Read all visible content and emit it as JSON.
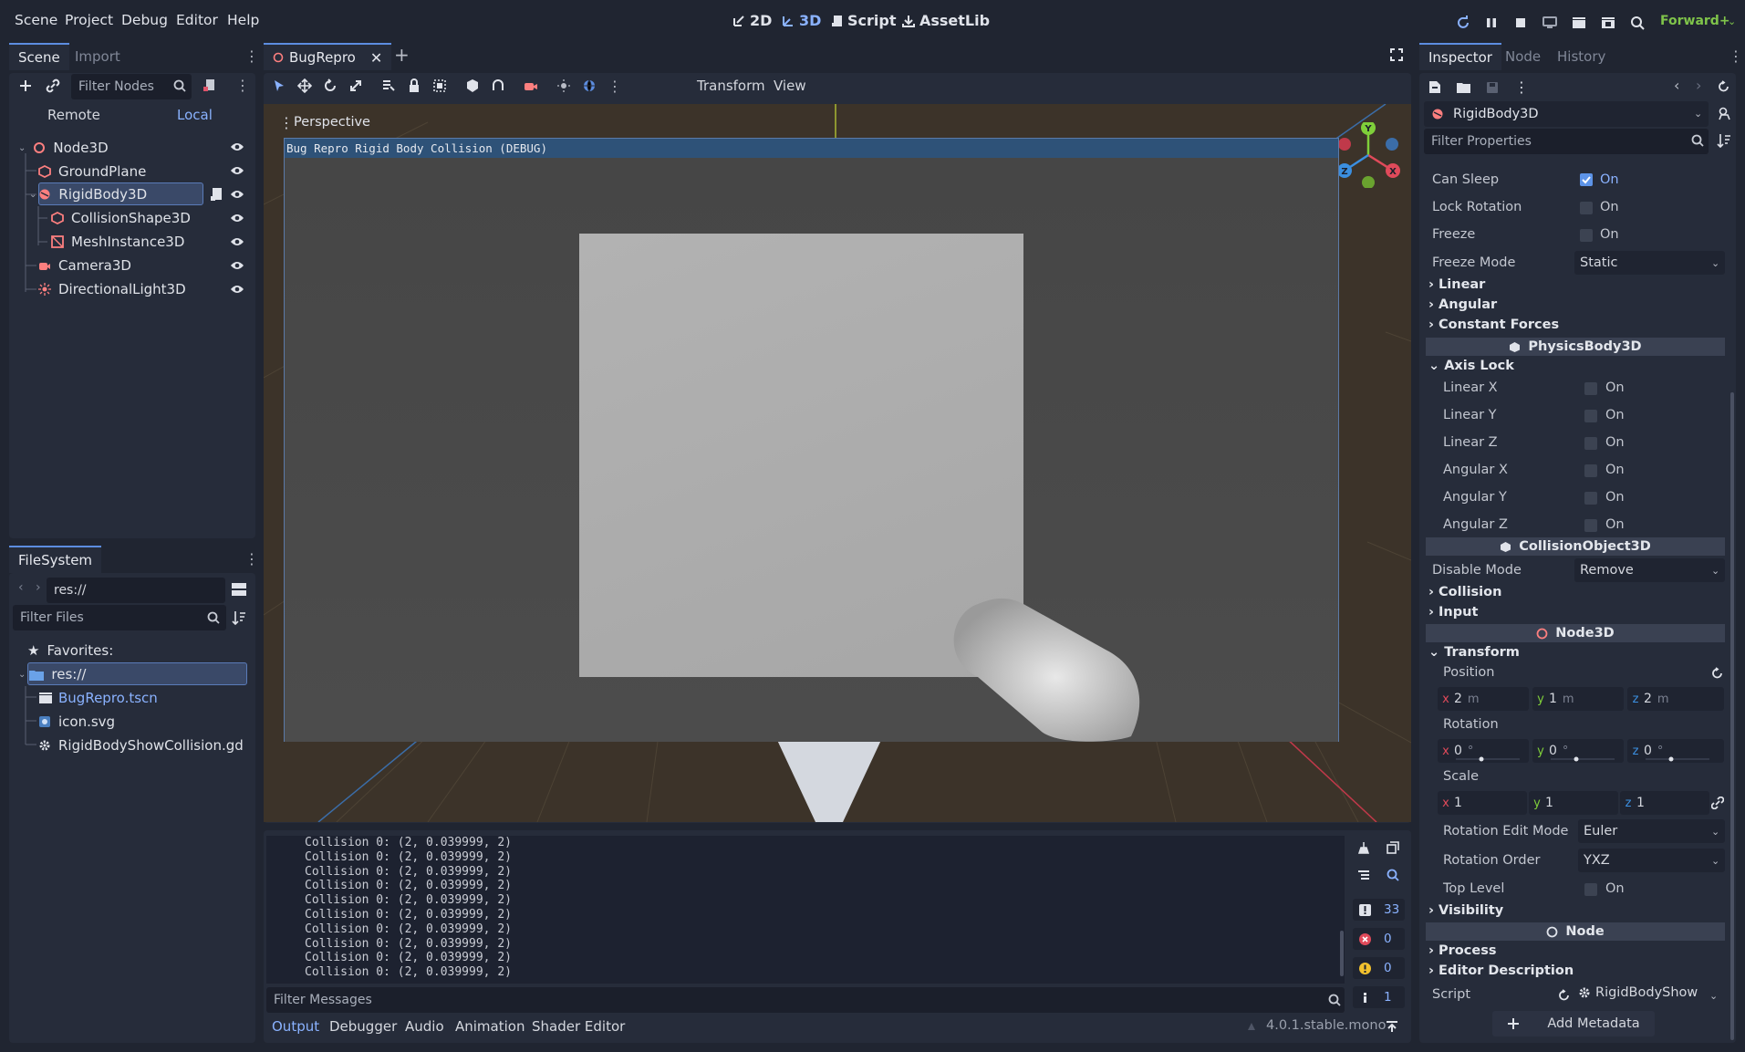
{
  "menu": [
    "Scene",
    "Project",
    "Debug",
    "Editor",
    "Help"
  ],
  "workspaces": {
    "w2d": "2D",
    "w3d": "3D",
    "script": "Script",
    "assetlib": "AssetLib"
  },
  "renderer": "Forward+",
  "scene_dock": {
    "tabs": [
      "Scene",
      "Import"
    ],
    "filter_placeholder": "Filter Nodes",
    "remote": "Remote",
    "local": "Local",
    "nodes": [
      "Node3D",
      "GroundPlane",
      "RigidBody3D",
      "CollisionShape3D",
      "MeshInstance3D",
      "Camera3D",
      "DirectionalLight3D"
    ]
  },
  "filesystem": {
    "tab": "FileSystem",
    "path": "res://",
    "filter_placeholder": "Filter Files",
    "favorites": "Favorites:",
    "root": "res://",
    "files": [
      "BugRepro.tscn",
      "icon.svg",
      "RigidBodyShowCollision.gd"
    ]
  },
  "editor_tabs": {
    "scene_tab": "BugRepro",
    "toolbar_transform": "Transform",
    "toolbar_view": "View"
  },
  "viewport": {
    "label": "Perspective",
    "game_window_title": "Bug Repro Rigid Body Collision (DEBUG)",
    "gizmo": {
      "y": "Y",
      "z": "Z",
      "x": "X"
    }
  },
  "output": {
    "lines": [
      "Collision 0: (2, 0.039999, 2)",
      "Collision 0: (2, 0.039999, 2)",
      "Collision 0: (2, 0.039999, 2)",
      "Collision 0: (2, 0.039999, 2)",
      "Collision 0: (2, 0.039999, 2)",
      "Collision 0: (2, 0.039999, 2)",
      "Collision 0: (2, 0.039999, 2)",
      "Collision 0: (2, 0.039999, 2)",
      "Collision 0: (2, 0.039999, 2)",
      "Collision 0: (2, 0.039999, 2)"
    ],
    "filter_placeholder": "Filter Messages",
    "counts": {
      "messages": "33",
      "errors": "0",
      "warnings": "0",
      "info": "1"
    }
  },
  "bottom_tabs": [
    "Output",
    "Debugger",
    "Audio",
    "Animation",
    "Shader Editor"
  ],
  "version": "4.0.1.stable.mono",
  "inspector": {
    "tabs": [
      "Inspector",
      "Node",
      "History"
    ],
    "object": "RigidBody3D",
    "filter_placeholder": "Filter Properties",
    "on": "On",
    "can_sleep": "Can Sleep",
    "lock_rotation": "Lock Rotation",
    "freeze": "Freeze",
    "freeze_mode": "Freeze Mode",
    "freeze_mode_value": "Static",
    "linear": "Linear",
    "angular": "Angular",
    "constant_forces": "Constant Forces",
    "physics_body": "PhysicsBody3D",
    "axis_lock": "Axis Lock",
    "axis_items": [
      "Linear X",
      "Linear Y",
      "Linear Z",
      "Angular X",
      "Angular Y",
      "Angular Z"
    ],
    "collision_object": "CollisionObject3D",
    "disable_mode": "Disable Mode",
    "disable_mode_value": "Remove",
    "collision": "Collision",
    "input": "Input",
    "node3d": "Node3D",
    "transform": "Transform",
    "position": "Position",
    "pos": {
      "x": "2",
      "y": "1",
      "z": "2",
      "unit": "m"
    },
    "rotation": "Rotation",
    "rot": {
      "x": "0",
      "y": "0",
      "z": "0",
      "unit": "°"
    },
    "scale": "Scale",
    "scl": {
      "x": "1",
      "y": "1",
      "z": "1"
    },
    "rotation_edit_mode": "Rotation Edit Mode",
    "rotation_edit_mode_value": "Euler",
    "rotation_order": "Rotation Order",
    "rotation_order_value": "YXZ",
    "top_level": "Top Level",
    "visibility": "Visibility",
    "node": "Node",
    "process": "Process",
    "editor_description": "Editor Description",
    "script": "Script",
    "script_value": "RigidBodyShow",
    "add_metadata": "Add Metadata",
    "axis": {
      "x": "x",
      "y": "y",
      "z": "z"
    }
  },
  "colors": {
    "accent": "#5c8de0",
    "axis_x": "#e04a5a",
    "axis_y": "#7fcf3a",
    "axis_z": "#3b8fe0"
  }
}
